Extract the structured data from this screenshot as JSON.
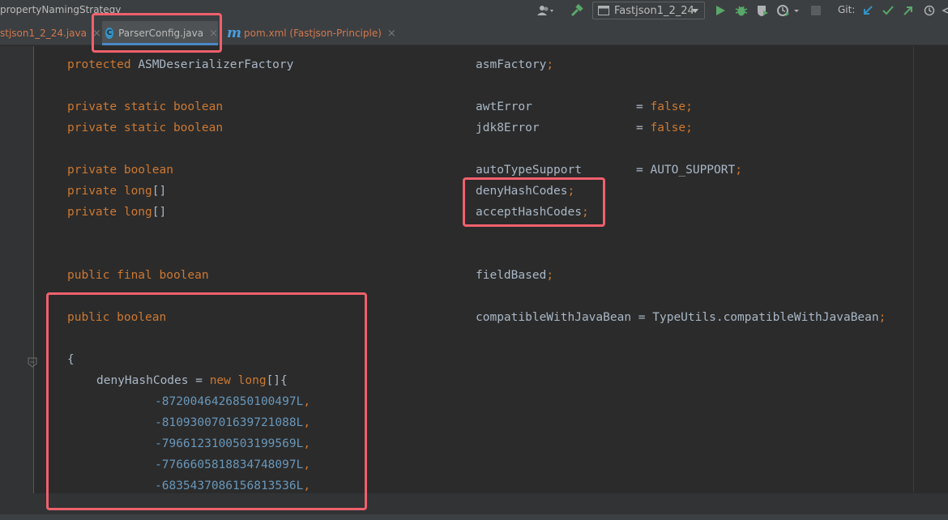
{
  "toolbar": {
    "breadcrumb": "propertyNamingStrategy",
    "run_config": "Fastjson1_2_24",
    "git_label": "Git:"
  },
  "tabs": [
    {
      "label": "stjson1_2_24.java",
      "color": "#d0784f",
      "active": false
    },
    {
      "label": "ParserConfig.java",
      "color": "#bbbbbb",
      "active": true,
      "icon": "class-icon",
      "icon_letter": "C"
    },
    {
      "label": "pom.xml (Fastjson-Principle)",
      "color": "#d0784f",
      "active": false,
      "icon": "maven-icon",
      "icon_letter": "m"
    }
  ],
  "tab_close_glyph": "×",
  "code": {
    "asm_decl_kw": "protected",
    "asm_decl_type": "ASMDeserializerFactory",
    "asm_decl_name": "asmFactory",
    "awt_kw": "private static boolean",
    "awt_name": "awtError",
    "jdk8_kw": "private static boolean",
    "jdk8_name": "jdk8Error",
    "eq": "=",
    "false_kw": "false",
    "auto_kw": "private boolean",
    "auto_name": "autoTypeSupport",
    "auto_val": "AUTO_SUPPORT",
    "deny_kw": "private long",
    "deny_brackets": "[]",
    "deny_name": "denyHashCodes",
    "accept_kw": "private long",
    "accept_brackets": "[]",
    "accept_name": "acceptHashCodes",
    "field_kw": "public final boolean",
    "field_name": "fieldBased",
    "compat_kw": "public boolean",
    "compat_name": "compatibleWithJavaBean",
    "compat_val": "TypeUtils.compatibleWithJavaBean",
    "semicolon": ";",
    "open_brace": "{",
    "deny_assign_name": "denyHashCodes",
    "deny_assign_new": "new",
    "deny_assign_type": "long",
    "deny_assign_tail": "[]{",
    "comma": ",",
    "hash_values": [
      "-8720046426850100497L",
      "-8109300701639721088L",
      "-7966123100503199569L",
      "-7766605818834748097L",
      "-6835437086156813536L"
    ]
  },
  "colors": {
    "keyword": "#cc7832",
    "identifier": "#a9b7c6",
    "number": "#6897bb",
    "annotation_box": "#f0606c",
    "active_tab_underline": "#4a88c7"
  }
}
